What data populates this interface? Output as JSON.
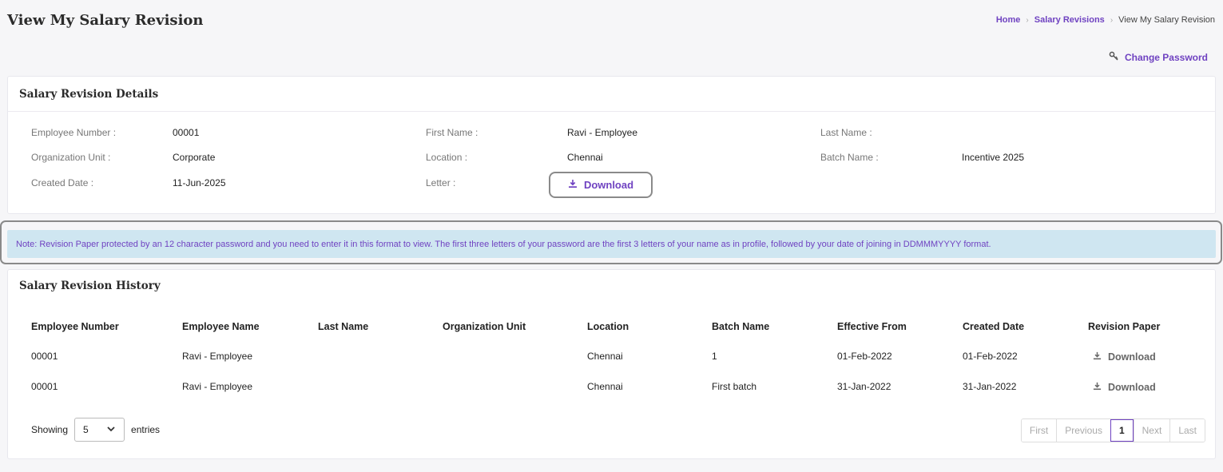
{
  "page": {
    "title": "View My Salary Revision"
  },
  "breadcrumb": {
    "home": "Home",
    "section": "Salary Revisions",
    "current": "View My Salary Revision"
  },
  "change_password": "Change Password",
  "details": {
    "title": "Salary Revision Details",
    "employee_number_label": "Employee Number :",
    "employee_number": "00001",
    "first_name_label": "First Name :",
    "first_name": "Ravi - Employee",
    "last_name_label": "Last Name :",
    "last_name": "",
    "org_unit_label": "Organization Unit :",
    "org_unit": "Corporate",
    "location_label": "Location :",
    "location": "Chennai",
    "batch_name_label": "Batch Name :",
    "batch_name": "Incentive 2025",
    "created_date_label": "Created Date :",
    "created_date": "11-Jun-2025",
    "letter_label": "Letter :",
    "download_label": "Download"
  },
  "note": "Note: Revision Paper protected by an 12 character password and you need to enter it in this format to view. The first three letters of your password are the first 3 letters of your name as in profile, followed by your date of joining in DDMMMYYYY format.",
  "history": {
    "title": "Salary Revision History",
    "columns": [
      "Employee Number",
      "Employee Name",
      "Last Name",
      "Organization Unit",
      "Location",
      "Batch Name",
      "Effective From",
      "Created Date",
      "Revision Paper"
    ],
    "rows": [
      {
        "employee_number": "00001",
        "employee_name": "Ravi - Employee",
        "last_name": "",
        "org_unit": "",
        "location": "Chennai",
        "batch_name": "1",
        "effective_from": "01-Feb-2022",
        "created_date": "01-Feb-2022",
        "revision_paper": "Download"
      },
      {
        "employee_number": "00001",
        "employee_name": "Ravi - Employee",
        "last_name": "",
        "org_unit": "",
        "location": "Chennai",
        "batch_name": "First batch",
        "effective_from": "31-Jan-2022",
        "created_date": "31-Jan-2022",
        "revision_paper": "Download"
      }
    ],
    "showing_label": "Showing",
    "entries_label": "entries",
    "page_size": "5",
    "pagination": {
      "first": "First",
      "previous": "Previous",
      "current": "1",
      "next": "Next",
      "last": "Last"
    }
  },
  "colors": {
    "accent": "#6f42c1",
    "note_bg": "#cfe6f1"
  }
}
